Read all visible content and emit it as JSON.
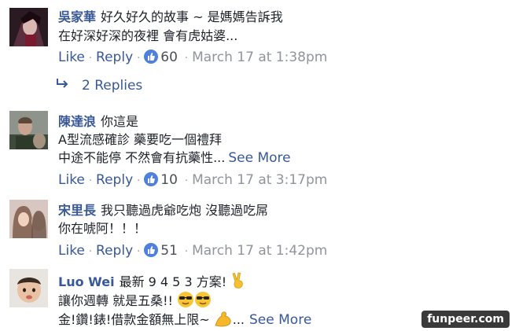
{
  "comments": [
    {
      "author": "吳家華",
      "lines": [
        "好久好久的故事 ~ 是媽媽告訴我",
        "在好深好深的夜裡 會有虎姑婆..."
      ],
      "like_label": "Like",
      "reply_label": "Reply",
      "like_count": "60",
      "timestamp": "March 17 at 1:38pm",
      "replies_label": "2 Replies"
    },
    {
      "author": "陳達浪",
      "lines": [
        "你這是",
        "A型流感確診 藥要吃一個禮拜",
        "中途不能停 不然會有抗藥性..."
      ],
      "see_more": "See More",
      "like_label": "Like",
      "reply_label": "Reply",
      "like_count": "10",
      "timestamp": "March 17 at 3:17pm"
    },
    {
      "author": "宋里長",
      "lines": [
        "我只聽過虎爺吃炮 沒聽過吃屌",
        "你在唬阿！！！"
      ],
      "like_label": "Like",
      "reply_label": "Reply",
      "like_count": "51",
      "timestamp": "March 17 at 1:42pm"
    },
    {
      "author": "Luo Wei",
      "lines": [
        "最新 9 4 5 3 方案!",
        "讓你週轉 就是五桑!!",
        "金!鑽!錶!借款金額無上限~"
      ],
      "see_more": "See More",
      "line_emojis": [
        "victory-hand-emoji",
        "sunglasses-face-emoji",
        "flexed-biceps-emoji"
      ]
    }
  ],
  "watermark": "funpeer.com",
  "colors": {
    "link": "#385898",
    "text": "#1d2129",
    "meta": "#90949c",
    "like_badge": "#4f7fdf"
  }
}
